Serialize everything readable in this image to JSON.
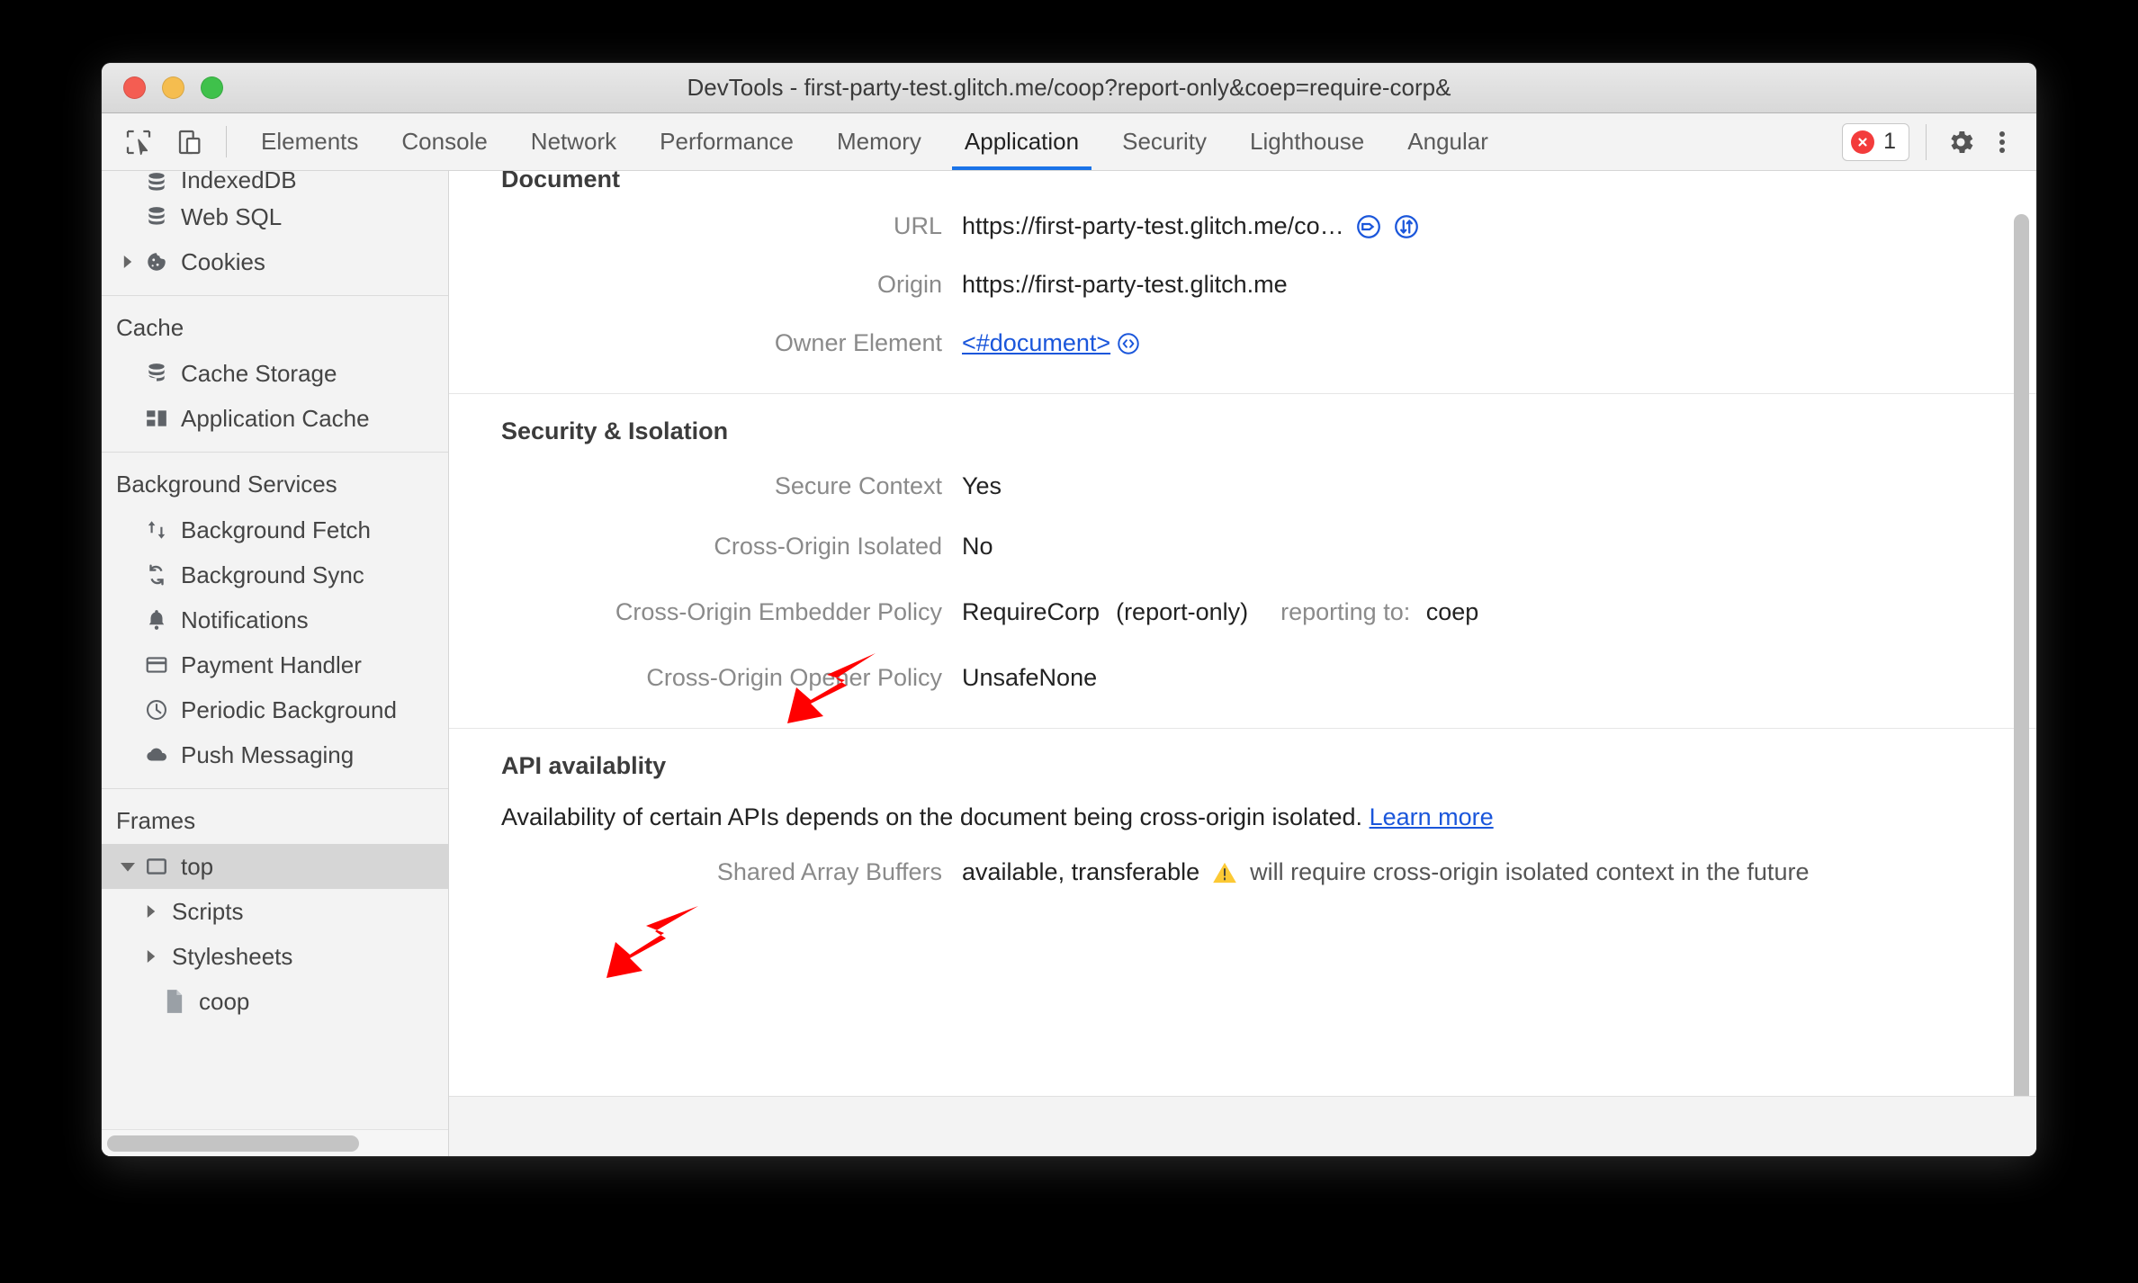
{
  "window": {
    "title": "DevTools - first-party-test.glitch.me/coop?report-only&coep=require-corp&",
    "controls": {
      "close": "close",
      "minimize": "minimize",
      "zoom": "zoom"
    }
  },
  "toolbar": {
    "inspect_icon": "inspect-element-icon",
    "device_icon": "device-toolbar-icon",
    "tabs": [
      {
        "label": "Elements",
        "active": false
      },
      {
        "label": "Console",
        "active": false
      },
      {
        "label": "Network",
        "active": false
      },
      {
        "label": "Performance",
        "active": false
      },
      {
        "label": "Memory",
        "active": false
      },
      {
        "label": "Application",
        "active": true
      },
      {
        "label": "Security",
        "active": false
      },
      {
        "label": "Lighthouse",
        "active": false
      },
      {
        "label": "Angular",
        "active": false
      }
    ],
    "error_badge": {
      "icon": "error-circle-icon",
      "count": "1"
    },
    "settings_label": "settings-gear-icon",
    "more_label": "more-options-icon",
    "active_accent": "#1a73e8",
    "error_color": "#f33c3c"
  },
  "sidebar": {
    "groups": [
      {
        "title": "",
        "items": [
          {
            "label": "IndexedDB",
            "icon": "database-icon",
            "indent": 1,
            "twisty": "",
            "selected": false,
            "clipped": true
          },
          {
            "label": "Web SQL",
            "icon": "database-icon",
            "indent": 1,
            "twisty": "",
            "selected": false
          },
          {
            "label": "Cookies",
            "icon": "cookie-icon",
            "indent": 0,
            "twisty": "collapsed",
            "selected": false
          }
        ]
      },
      {
        "title": "Cache",
        "items": [
          {
            "label": "Cache Storage",
            "icon": "database-icon",
            "indent": 1,
            "twisty": "",
            "selected": false
          },
          {
            "label": "Application Cache",
            "icon": "grid-icon",
            "indent": 1,
            "twisty": "",
            "selected": false
          }
        ]
      },
      {
        "title": "Background Services",
        "items": [
          {
            "label": "Background Fetch",
            "icon": "updown-arrows-icon",
            "indent": 1,
            "twisty": "",
            "selected": false
          },
          {
            "label": "Background Sync",
            "icon": "sync-icon",
            "indent": 1,
            "twisty": "",
            "selected": false
          },
          {
            "label": "Notifications",
            "icon": "bell-icon",
            "indent": 1,
            "twisty": "",
            "selected": false
          },
          {
            "label": "Payment Handler",
            "icon": "credit-card-icon",
            "indent": 1,
            "twisty": "",
            "selected": false
          },
          {
            "label": "Periodic Background",
            "icon": "clock-icon",
            "indent": 1,
            "twisty": "",
            "selected": false
          },
          {
            "label": "Push Messaging",
            "icon": "cloud-icon",
            "indent": 1,
            "twisty": "",
            "selected": false
          }
        ]
      },
      {
        "title": "Frames",
        "items": [
          {
            "label": "top",
            "icon": "frame-icon",
            "indent": 0,
            "twisty": "expanded",
            "selected": true
          },
          {
            "label": "Scripts",
            "icon": "",
            "indent": 1,
            "twisty": "collapsed",
            "selected": false
          },
          {
            "label": "Stylesheets",
            "icon": "",
            "indent": 1,
            "twisty": "collapsed",
            "selected": false
          },
          {
            "label": "coop",
            "icon": "document-icon",
            "indent": 2,
            "twisty": "",
            "selected": false
          }
        ]
      }
    ]
  },
  "main": {
    "sections": [
      {
        "name": "document",
        "heading": "Document",
        "heading_clipped": true,
        "rows": [
          {
            "key": "URL",
            "value": "https://first-party-test.glitch.me/co…",
            "icons": [
              "open-in-elements-icon",
              "open-in-network-icon"
            ]
          },
          {
            "key": "Origin",
            "value": "https://first-party-test.glitch.me",
            "icons": []
          },
          {
            "key": "Owner Element",
            "value": "<#document>",
            "link": true,
            "icons": [
              "reveal-in-elements-icon"
            ]
          }
        ]
      },
      {
        "name": "security-isolation",
        "heading": "Security & Isolation",
        "rows": [
          {
            "key": "Secure Context",
            "value": "Yes",
            "icons": []
          },
          {
            "key": "Cross-Origin Isolated",
            "value": "No",
            "icons": []
          },
          {
            "key": "Cross-Origin Embedder Policy",
            "value": "RequireCorp",
            "suffix": "(report-only)",
            "report_label": "reporting to:",
            "report_value": "coep",
            "icons": []
          },
          {
            "key": "Cross-Origin Opener Policy",
            "value": "UnsafeNone",
            "icons": []
          }
        ]
      },
      {
        "name": "api-availability",
        "heading": "API availablity",
        "description_text": "Availability of certain APIs depends on the document being cross-origin isolated. ",
        "description_link": "Learn more",
        "rows": [
          {
            "key": "Shared Array Buffers",
            "value": "available, transferable",
            "warning_icon": "warning-triangle-icon",
            "warning_text": "will require cross-origin isolated context in the future",
            "icons": []
          }
        ]
      }
    ]
  },
  "annotations": {
    "arrow_color": "#ff0000",
    "arrows": [
      {
        "name": "arrow-pointing-cross-origin-isolated",
        "target": "Cross-Origin Isolated value"
      },
      {
        "name": "arrow-pointing-api-availability",
        "target": "API availablity heading"
      }
    ]
  },
  "scrollbars": {
    "main_vertical": "main-vertical-scrollbar",
    "sidebar_horizontal": "sidebar-horizontal-scrollbar"
  }
}
